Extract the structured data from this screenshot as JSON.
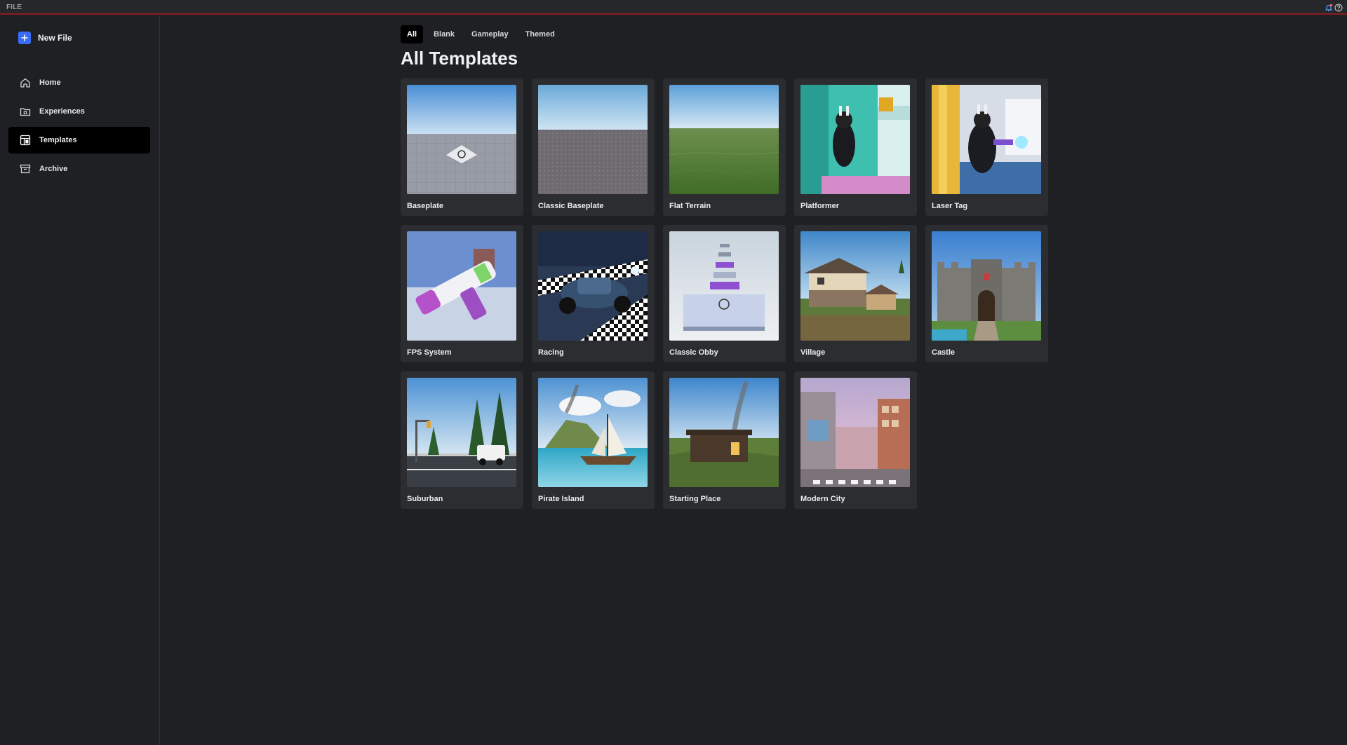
{
  "topbar": {
    "file_label": "FILE",
    "icons": [
      "notification-icon",
      "help-icon"
    ]
  },
  "sidebar": {
    "new_file": {
      "label": "New File",
      "icon": "plus-icon"
    },
    "items": [
      {
        "label": "Home",
        "icon": "home-icon",
        "active": false
      },
      {
        "label": "Experiences",
        "icon": "folder-icon",
        "active": false
      },
      {
        "label": "Templates",
        "icon": "templates-icon",
        "active": true
      },
      {
        "label": "Archive",
        "icon": "archive-icon",
        "active": false
      }
    ]
  },
  "main": {
    "tabs": [
      {
        "label": "All",
        "active": true
      },
      {
        "label": "Blank",
        "active": false
      },
      {
        "label": "Gameplay",
        "active": false
      },
      {
        "label": "Themed",
        "active": false
      }
    ],
    "title": "All Templates",
    "templates": [
      {
        "name": "Baseplate",
        "thumb": "baseplate"
      },
      {
        "name": "Classic Baseplate",
        "thumb": "classic"
      },
      {
        "name": "Flat Terrain",
        "thumb": "terrain"
      },
      {
        "name": "Platformer",
        "thumb": "platformer"
      },
      {
        "name": "Laser Tag",
        "thumb": "lasertag"
      },
      {
        "name": "FPS System",
        "thumb": "fps"
      },
      {
        "name": "Racing",
        "thumb": "racing"
      },
      {
        "name": "Classic Obby",
        "thumb": "obby"
      },
      {
        "name": "Village",
        "thumb": "village"
      },
      {
        "name": "Castle",
        "thumb": "castle"
      },
      {
        "name": "Suburban",
        "thumb": "suburban"
      },
      {
        "name": "Pirate Island",
        "thumb": "pirate"
      },
      {
        "name": "Starting Place",
        "thumb": "starting"
      },
      {
        "name": "Modern City",
        "thumb": "city"
      }
    ]
  },
  "colors": {
    "accent": "#3b6cf5",
    "topbar_border": "#8c1c22",
    "background": "#1f2024",
    "card": "#2c2d31"
  }
}
